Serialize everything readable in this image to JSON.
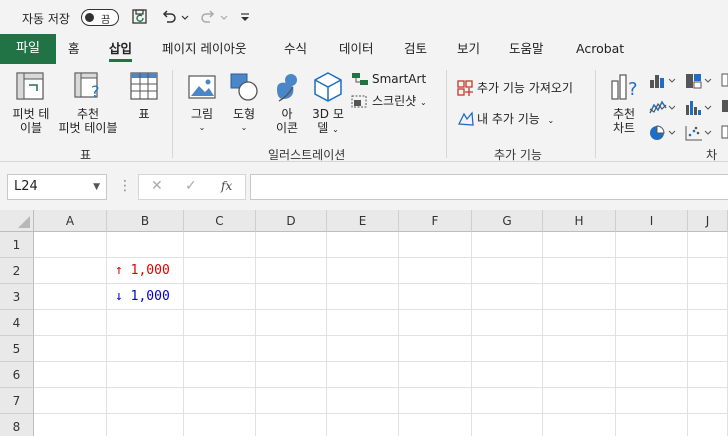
{
  "qat": {
    "autosave_label": "자동 저장",
    "autosave_state": "끔"
  },
  "tabs": {
    "file": "파일",
    "items": [
      "홈",
      "삽입",
      "페이지 레이아웃",
      "수식",
      "데이터",
      "검토",
      "보기",
      "도움말",
      "Acrobat"
    ],
    "active": "삽입"
  },
  "ribbon": {
    "pivot_table": [
      "피벗 테",
      "이블"
    ],
    "rec_pivot": [
      "추천",
      "피벗 테이블"
    ],
    "table": "표",
    "picture": "그림",
    "shapes": "도형",
    "icons": [
      "아",
      "이콘"
    ],
    "models3d": [
      "3D 모",
      "델"
    ],
    "smartart": "SmartArt",
    "screenshot": "스크린샷",
    "get_addins": "추가 기능 가져오기",
    "my_addins": "내 추가 기능",
    "rec_charts": [
      "추천",
      "차트"
    ],
    "groups": {
      "tables": "표",
      "illustrations": "일러스트레이션",
      "addins": "추가 기능",
      "charts": "차트"
    }
  },
  "formula_bar": {
    "name_box": "L24",
    "fx": "fx",
    "value": ""
  },
  "grid": {
    "columns": [
      "A",
      "B",
      "C",
      "D",
      "E",
      "F",
      "G",
      "H",
      "I",
      "J"
    ],
    "rows": [
      "1",
      "2",
      "3",
      "4",
      "5",
      "6",
      "7",
      "8"
    ],
    "cells": {
      "B2": {
        "text": "↑ 1,000",
        "color": "#e00000"
      },
      "B3": {
        "text": "↓ 1,000",
        "color": "#0000d0"
      }
    }
  },
  "colors": {
    "accent": "#217346"
  }
}
